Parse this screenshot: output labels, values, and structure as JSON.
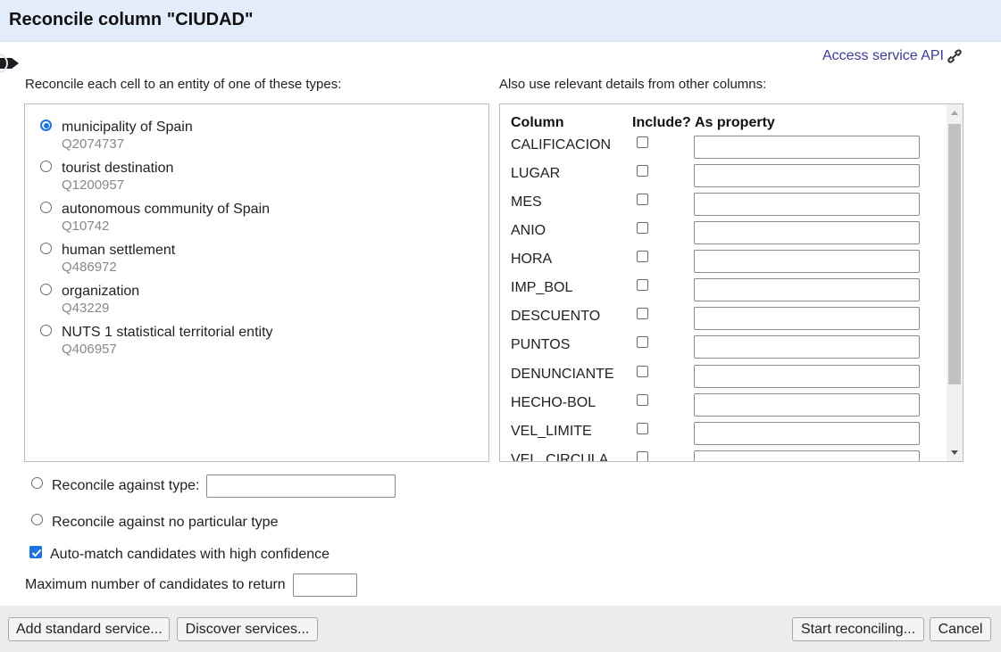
{
  "dialog": {
    "title": "Reconcile column \"CIUDAD\""
  },
  "service": {
    "api_link": "Access service API"
  },
  "types_section": {
    "label": "Reconcile each cell to an entity of one of these types:",
    "selected_index": 0,
    "types": [
      {
        "name": "municipality of Spain",
        "qid": "Q2074737"
      },
      {
        "name": "tourist destination",
        "qid": "Q1200957"
      },
      {
        "name": "autonomous community of Spain",
        "qid": "Q10742"
      },
      {
        "name": "human settlement",
        "qid": "Q486972"
      },
      {
        "name": "organization",
        "qid": "Q43229"
      },
      {
        "name": "NUTS 1 statistical territorial entity",
        "qid": "Q406957"
      }
    ]
  },
  "columns_section": {
    "label": "Also use relevant details from other columns:",
    "headers": {
      "column": "Column",
      "include": "Include?",
      "property": "As property"
    },
    "rows": [
      {
        "name": "CALIFICACION",
        "include": false,
        "property": ""
      },
      {
        "name": "LUGAR",
        "include": false,
        "property": ""
      },
      {
        "name": "MES",
        "include": false,
        "property": ""
      },
      {
        "name": "ANIO",
        "include": false,
        "property": ""
      },
      {
        "name": "HORA",
        "include": false,
        "property": ""
      },
      {
        "name": "IMP_BOL",
        "include": false,
        "property": ""
      },
      {
        "name": "DESCUENTO",
        "include": false,
        "property": ""
      },
      {
        "name": "PUNTOS",
        "include": false,
        "property": ""
      },
      {
        "name": "DENUNCIANTE",
        "include": false,
        "property": ""
      },
      {
        "name": "HECHO-BOL",
        "include": false,
        "property": ""
      },
      {
        "name": "VEL_LIMITE",
        "include": false,
        "property": ""
      },
      {
        "name": "VEL_CIRCULA",
        "include": false,
        "property": ""
      }
    ]
  },
  "options": {
    "against_type_label": "Reconcile against type:",
    "against_type_value": "",
    "no_type_label": "Reconcile against no particular type",
    "auto_match_label": "Auto-match candidates with high confidence",
    "auto_match_checked": true,
    "max_candidates_label": "Maximum number of candidates to return",
    "max_candidates_value": ""
  },
  "buttons": {
    "add_standard": "Add standard service...",
    "discover": "Discover services...",
    "start": "Start reconciling...",
    "cancel": "Cancel"
  },
  "colors": {
    "title_bg": "#e3ecfb",
    "accent": "#1a73e8",
    "link": "#3a3aa6",
    "footer_bg": "#ececec"
  },
  "icons": {
    "service_tag": "tag-icon",
    "api_link": "link-icon"
  }
}
